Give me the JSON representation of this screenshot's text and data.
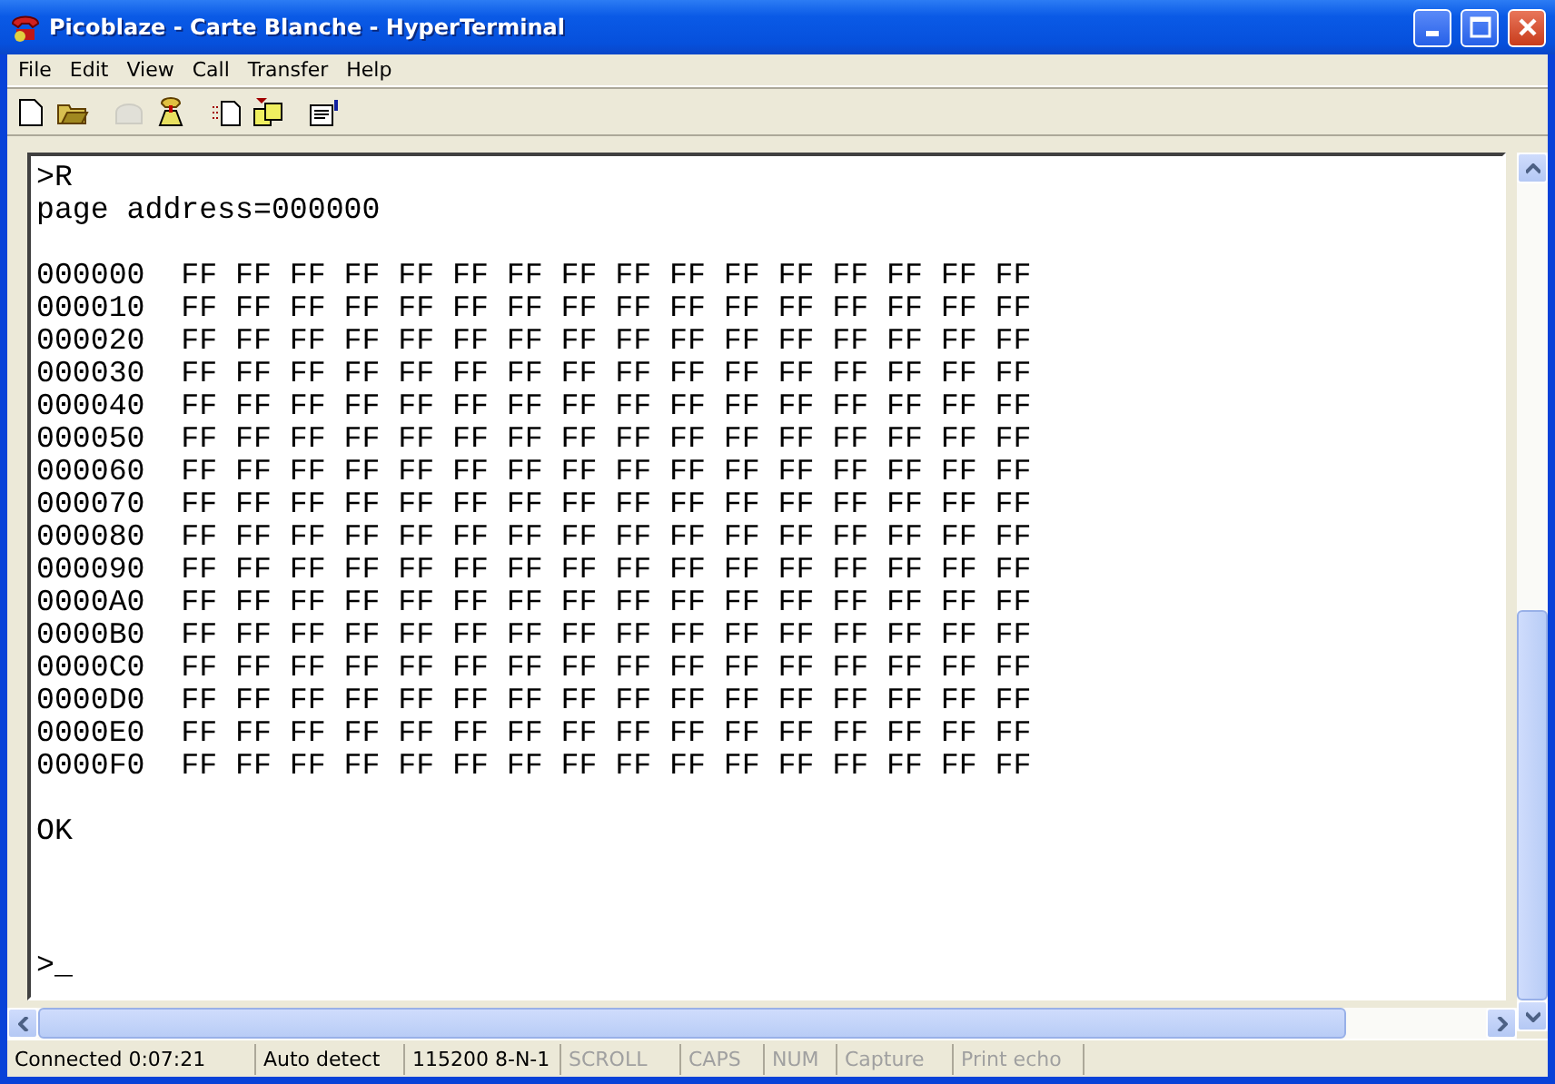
{
  "window": {
    "title": "Picoblaze - Carte Blanche - HyperTerminal"
  },
  "menu": [
    "File",
    "Edit",
    "View",
    "Call",
    "Transfer",
    "Help"
  ],
  "toolbar": [
    {
      "kind": "new",
      "disabled": false
    },
    {
      "kind": "open",
      "disabled": false
    },
    {
      "kind": "call",
      "disabled": true
    },
    {
      "kind": "hangup",
      "disabled": false
    },
    {
      "kind": "send",
      "disabled": false
    },
    {
      "kind": "receive",
      "disabled": false
    },
    {
      "kind": "properties",
      "disabled": false
    }
  ],
  "terminal": {
    "groups": [
      [
        ">R",
        "page address=000000"
      ],
      [
        "000000  FF FF FF FF FF FF FF FF FF FF FF FF FF FF FF FF",
        "000010  FF FF FF FF FF FF FF FF FF FF FF FF FF FF FF FF",
        "000020  FF FF FF FF FF FF FF FF FF FF FF FF FF FF FF FF",
        "000030  FF FF FF FF FF FF FF FF FF FF FF FF FF FF FF FF",
        "000040  FF FF FF FF FF FF FF FF FF FF FF FF FF FF FF FF",
        "000050  FF FF FF FF FF FF FF FF FF FF FF FF FF FF FF FF",
        "000060  FF FF FF FF FF FF FF FF FF FF FF FF FF FF FF FF",
        "000070  FF FF FF FF FF FF FF FF FF FF FF FF FF FF FF FF",
        "000080  FF FF FF FF FF FF FF FF FF FF FF FF FF FF FF FF",
        "000090  FF FF FF FF FF FF FF FF FF FF FF FF FF FF FF FF",
        "0000A0  FF FF FF FF FF FF FF FF FF FF FF FF FF FF FF FF",
        "0000B0  FF FF FF FF FF FF FF FF FF FF FF FF FF FF FF FF",
        "0000C0  FF FF FF FF FF FF FF FF FF FF FF FF FF FF FF FF",
        "0000D0  FF FF FF FF FF FF FF FF FF FF FF FF FF FF FF FF",
        "0000E0  FF FF FF FF FF FF FF FF FF FF FF FF FF FF FF FF",
        "0000F0  FF FF FF FF FF FF FF FF FF FF FF FF FF FF FF FF"
      ],
      [
        "OK"
      ]
    ],
    "prompt": ">_"
  },
  "status_bar": [
    {
      "text": "Connected 0:07:21",
      "disabled": false
    },
    {
      "text": "Auto detect",
      "disabled": false
    },
    {
      "text": "115200 8-N-1",
      "disabled": false
    },
    {
      "text": "SCROLL",
      "disabled": true
    },
    {
      "text": "CAPS",
      "disabled": true
    },
    {
      "text": "NUM",
      "disabled": true
    },
    {
      "text": "Capture",
      "disabled": true
    },
    {
      "text": "Print echo",
      "disabled": true
    }
  ]
}
